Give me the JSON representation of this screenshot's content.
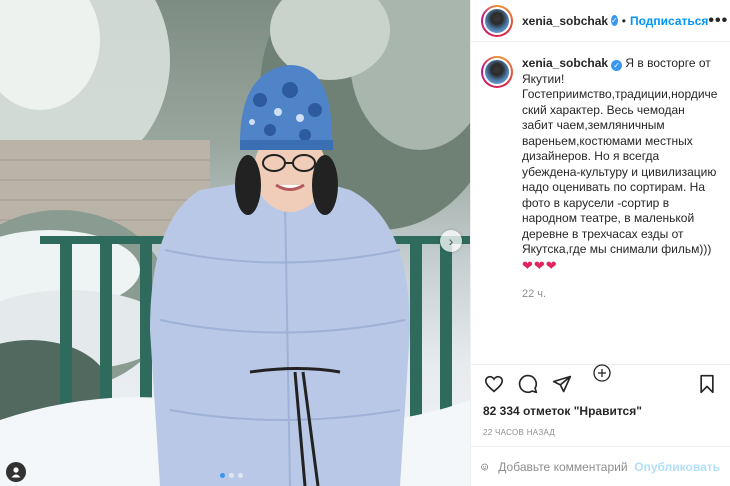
{
  "post": {
    "username": "xenia_sobchak",
    "follow_label": "Подписаться",
    "header_separator": "•",
    "more_label": "•••",
    "caption": "Я в восторге от Якутии! Гостеприимство,традиции,нордический характер. Весь чемодан забит чаем,земляничным вареньем,костюмами местных дизайнеров. Но я всегда убеждена-культуру и цивилизацию надо оценивать по сортирам. На фото в карусели -сортир в народном театре, в маленькой деревне в трехчасах езды от Якутска,где мы снимали фильм)))",
    "hearts": "❤❤❤",
    "caption_time": "22 ч.",
    "likes_text": "82 334 отметок \"Нравится\"",
    "date_text": "22 ЧАСОВ НАЗАД"
  },
  "comment": {
    "placeholder": "Добавьте комментарий...",
    "publish_label": "Опубликовать"
  },
  "carousel": {
    "slide_count": 3,
    "active_index": 0
  },
  "colors": {
    "accent": "#0095f6",
    "verified": "#3897f0",
    "heart": "#e0245e",
    "muted": "#8e8e8e",
    "jacket": "#b9c8e6"
  },
  "icons": {
    "like": "heart-outline-icon",
    "comment": "comment-bubble-icon",
    "share": "paper-plane-icon",
    "save": "bookmark-icon",
    "emoji": "smiley-icon",
    "add_comment": "plus-circle-icon",
    "next": "chevron-right-icon",
    "tag": "user-tag-icon"
  }
}
